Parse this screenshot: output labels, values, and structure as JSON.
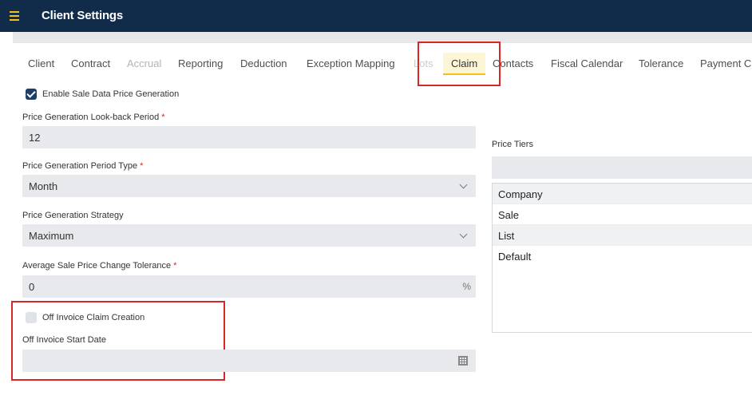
{
  "header": {
    "title": "Client Settings",
    "menu_icon": "hamburger-menu-icon",
    "accent": "#f3c01a",
    "bg": "#112c4b"
  },
  "tabs": [
    {
      "label": "Client",
      "state": "normal"
    },
    {
      "label": "Contract",
      "state": "normal"
    },
    {
      "label": "Accrual",
      "state": "disabled"
    },
    {
      "label": "Reporting",
      "state": "normal"
    },
    {
      "label": "Deduction",
      "state": "normal"
    },
    {
      "label": "Exception Mapping",
      "state": "normal"
    },
    {
      "label": "Lots",
      "state": "faded"
    },
    {
      "label": "Claim",
      "state": "active"
    },
    {
      "label": "Contacts",
      "state": "normal"
    },
    {
      "label": "Fiscal Calendar",
      "state": "normal"
    },
    {
      "label": "Tolerance",
      "state": "normal"
    },
    {
      "label": "Payment C",
      "state": "normal"
    }
  ],
  "form": {
    "enable_price_generation": {
      "label": "Enable Sale Data Price Generation",
      "checked": true
    },
    "lookback": {
      "label": "Price Generation Look-back Period",
      "required_mark": "*",
      "value": "12"
    },
    "period_type": {
      "label": "Price Generation Period Type",
      "required_mark": "*",
      "value": "Month"
    },
    "strategy": {
      "label": "Price Generation Strategy",
      "value": "Maximum"
    },
    "tolerance": {
      "label": "Average Sale Price Change Tolerance",
      "required_mark": "*",
      "value": "0",
      "suffix": "%"
    },
    "off_invoice_claim": {
      "label": "Off Invoice Claim Creation",
      "checked": false
    },
    "off_invoice_start": {
      "label": "Off Invoice Start Date",
      "value": "",
      "icon": "calendar-icon"
    }
  },
  "price_tiers": {
    "label": "Price Tiers",
    "items": [
      "Company",
      "Sale",
      "List",
      "Default"
    ]
  }
}
